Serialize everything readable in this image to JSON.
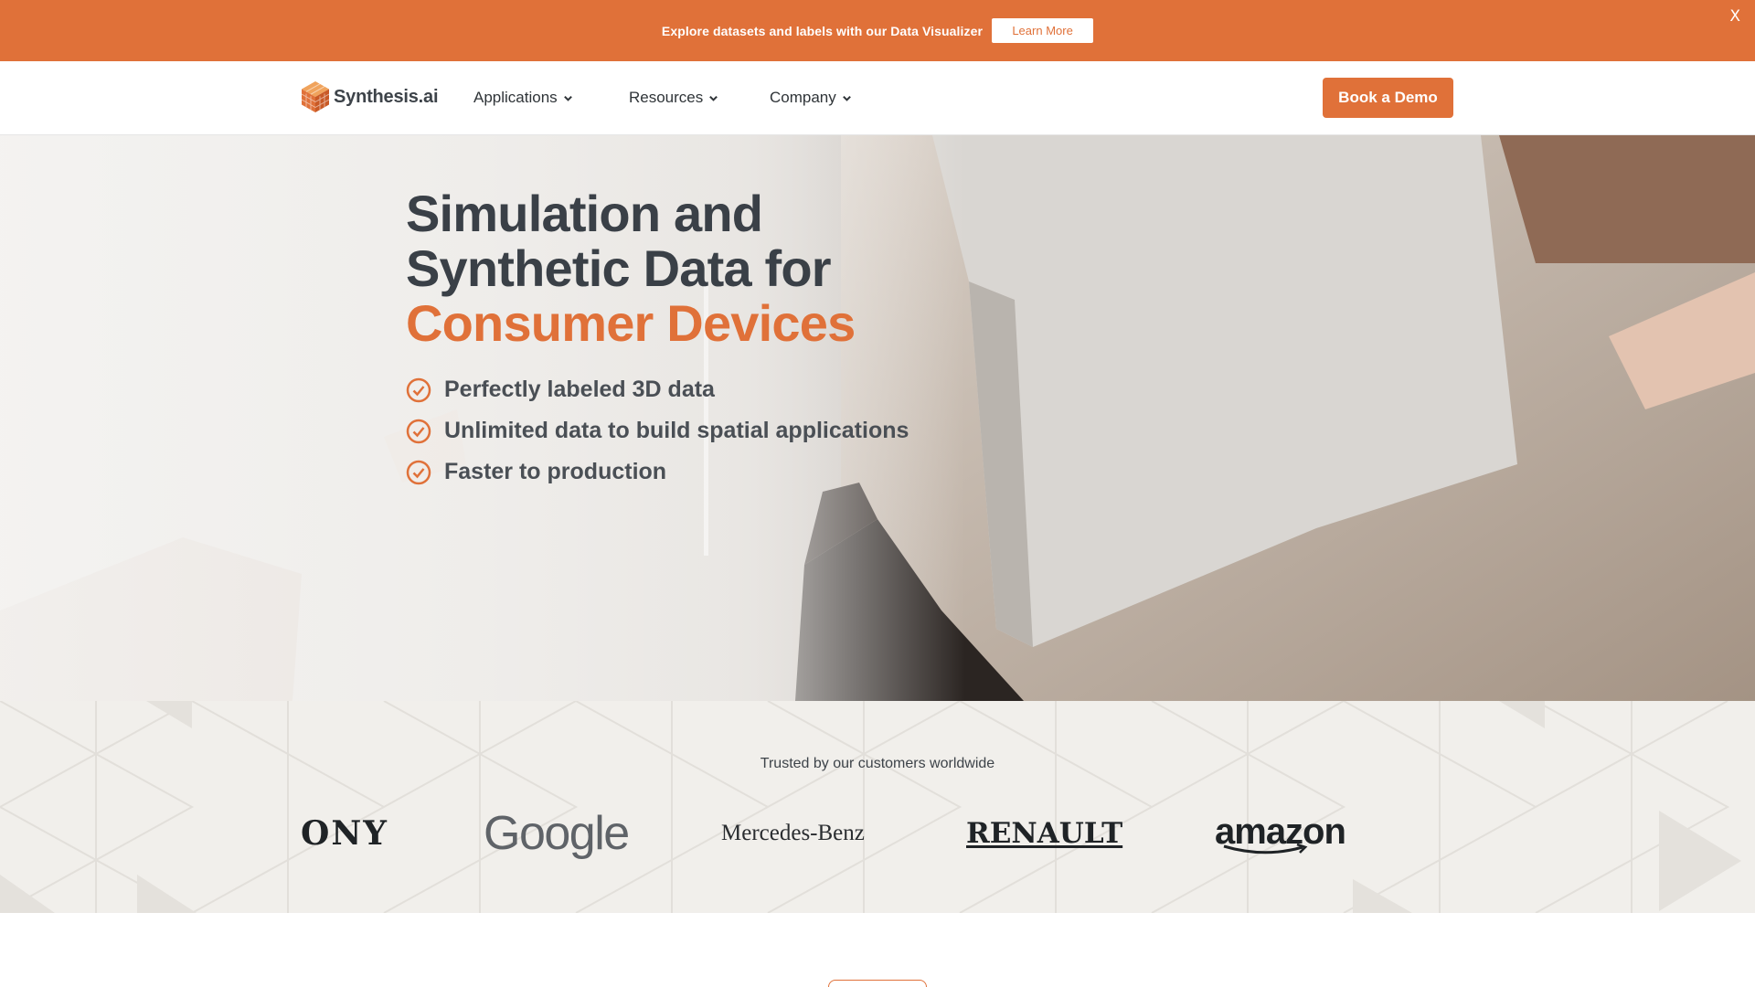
{
  "announcement": {
    "text": "Explore datasets and labels with our Data Visualizer",
    "button": "Learn More",
    "close": "X"
  },
  "nav": {
    "logo_text": "Synthesis.ai",
    "items": [
      {
        "label": "Applications"
      },
      {
        "label": "Resources"
      },
      {
        "label": "Company"
      }
    ],
    "cta": "Book a Demo"
  },
  "hero": {
    "title_line1": "Simulation and",
    "title_line2": "Synthetic Data for",
    "title_accent": "Consumer Devices",
    "bullets": [
      "Perfectly labeled 3D data",
      "Unlimited data to build spatial applications",
      "Faster to production"
    ]
  },
  "trusted": {
    "title": "Trusted by our customers worldwide",
    "logos": [
      "ONY",
      "Google",
      "Mercedes-Benz",
      "RENAULT",
      "amazon"
    ]
  },
  "colors": {
    "accent": "#e07139",
    "text": "#3d4349"
  }
}
